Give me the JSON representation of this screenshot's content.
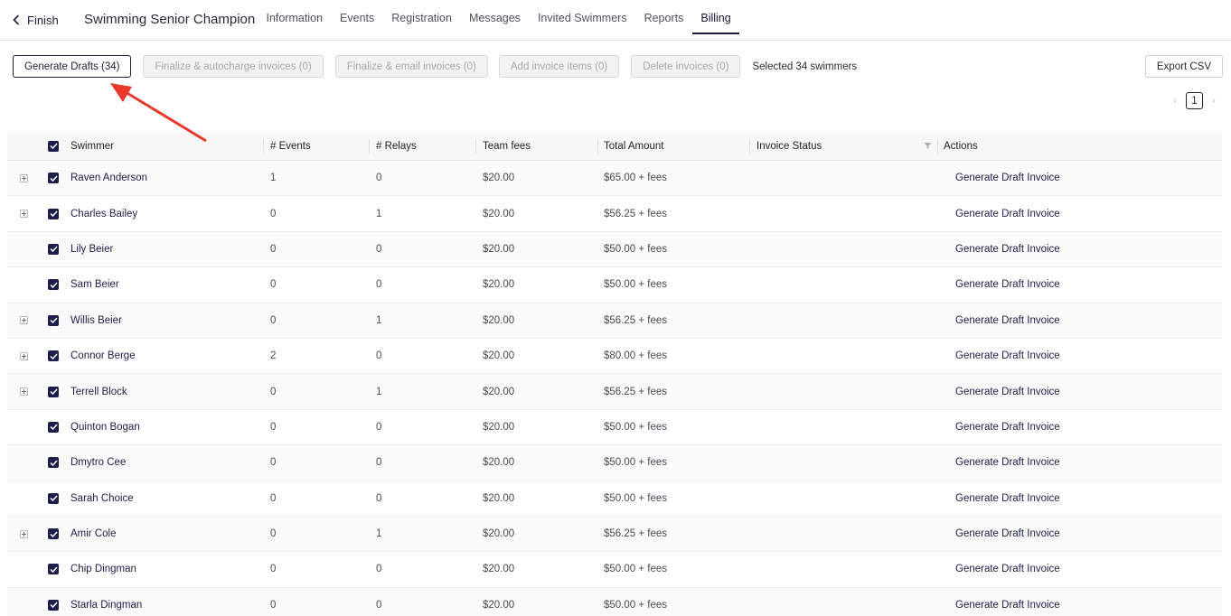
{
  "nav": {
    "back_label": "Finish",
    "event_title": "Swimming Senior Champion",
    "tabs": [
      {
        "label": "Information"
      },
      {
        "label": "Events"
      },
      {
        "label": "Registration"
      },
      {
        "label": "Messages"
      },
      {
        "label": "Invited Swimmers"
      },
      {
        "label": "Reports"
      },
      {
        "label": "Billing",
        "active": true
      }
    ]
  },
  "toolbar": {
    "generate_drafts": "Generate Drafts (34)",
    "finalize_autocharge": "Finalize & autocharge invoices (0)",
    "finalize_email": "Finalize & email invoices (0)",
    "add_items": "Add invoice items (0)",
    "delete_invoices": "Delete invoices (0)",
    "selected_text": "Selected 34 swimmers",
    "export_csv": "Export CSV"
  },
  "pagination": {
    "current_page": "1",
    "prev_icon": "chevron-left-icon",
    "next_icon": "chevron-right-icon"
  },
  "table": {
    "columns": {
      "swimmer": "Swimmer",
      "events": "# Events",
      "relays": "# Relays",
      "team_fees": "Team fees",
      "total": "Total Amount",
      "status": "Invoice Status",
      "actions": "Actions"
    },
    "rows": [
      {
        "expandable": true,
        "name": "Raven Anderson",
        "events": "1",
        "relays": "0",
        "team_fees": "$20.00",
        "total": "$65.00 + fees",
        "status": "",
        "action": "Generate Draft Invoice"
      },
      {
        "expandable": true,
        "name": "Charles Bailey",
        "events": "0",
        "relays": "1",
        "team_fees": "$20.00",
        "total": "$56.25 + fees",
        "status": "",
        "action": "Generate Draft Invoice"
      },
      {
        "expandable": false,
        "name": "Lily Beier",
        "events": "0",
        "relays": "0",
        "team_fees": "$20.00",
        "total": "$50.00 + fees",
        "status": "",
        "action": "Generate Draft Invoice"
      },
      {
        "expandable": false,
        "name": "Sam Beier",
        "events": "0",
        "relays": "0",
        "team_fees": "$20.00",
        "total": "$50.00 + fees",
        "status": "",
        "action": "Generate Draft Invoice"
      },
      {
        "expandable": true,
        "name": "Willis Beier",
        "events": "0",
        "relays": "1",
        "team_fees": "$20.00",
        "total": "$56.25 + fees",
        "status": "",
        "action": "Generate Draft Invoice"
      },
      {
        "expandable": true,
        "name": "Connor Berge",
        "events": "2",
        "relays": "0",
        "team_fees": "$20.00",
        "total": "$80.00 + fees",
        "status": "",
        "action": "Generate Draft Invoice"
      },
      {
        "expandable": true,
        "name": "Terrell Block",
        "events": "0",
        "relays": "1",
        "team_fees": "$20.00",
        "total": "$56.25 + fees",
        "status": "",
        "action": "Generate Draft Invoice"
      },
      {
        "expandable": false,
        "name": "Quinton Bogan",
        "events": "0",
        "relays": "0",
        "team_fees": "$20.00",
        "total": "$50.00 + fees",
        "status": "",
        "action": "Generate Draft Invoice"
      },
      {
        "expandable": false,
        "name": "Dmytro Cee",
        "events": "0",
        "relays": "0",
        "team_fees": "$20.00",
        "total": "$50.00 + fees",
        "status": "",
        "action": "Generate Draft Invoice"
      },
      {
        "expandable": false,
        "name": "Sarah Choice",
        "events": "0",
        "relays": "0",
        "team_fees": "$20.00",
        "total": "$50.00 + fees",
        "status": "",
        "action": "Generate Draft Invoice"
      },
      {
        "expandable": true,
        "name": "Amir Cole",
        "events": "0",
        "relays": "1",
        "team_fees": "$20.00",
        "total": "$56.25 + fees",
        "status": "",
        "action": "Generate Draft Invoice"
      },
      {
        "expandable": false,
        "name": "Chip Dingman",
        "events": "0",
        "relays": "0",
        "team_fees": "$20.00",
        "total": "$50.00 + fees",
        "status": "",
        "action": "Generate Draft Invoice"
      },
      {
        "expandable": false,
        "name": "Starla Dingman",
        "events": "0",
        "relays": "0",
        "team_fees": "$20.00",
        "total": "$50.00 + fees",
        "status": "",
        "action": "Generate Draft Invoice"
      }
    ]
  },
  "colors": {
    "accent": "#1c1f4a",
    "annotation": "#e8392b",
    "disabled_bg": "#f2f2f2"
  }
}
